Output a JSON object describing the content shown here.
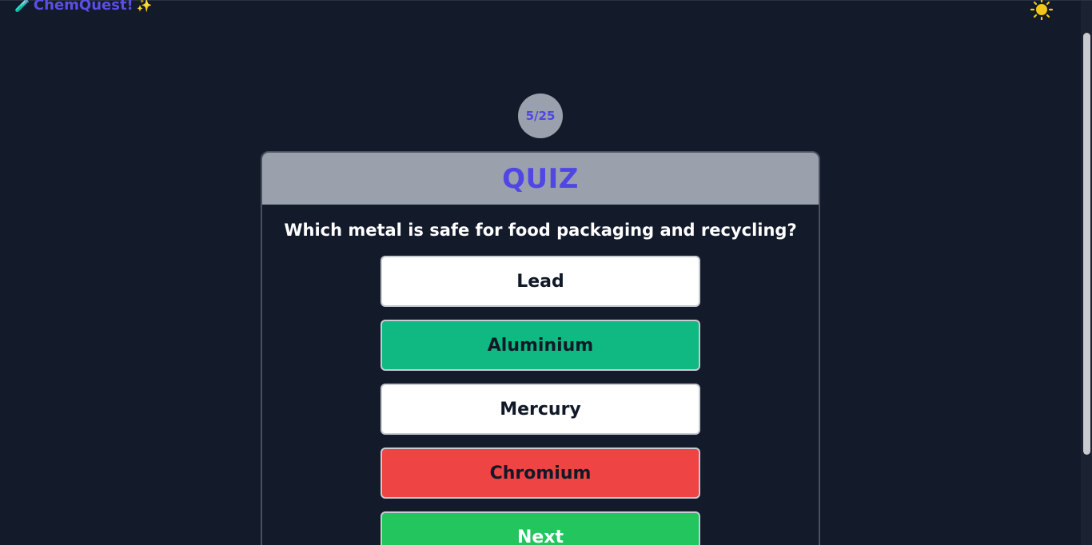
{
  "brand": {
    "title": "ChemQuest!",
    "icon_left": "test-tube-icon",
    "icon_right": "sparkles-icon"
  },
  "theme_toggle": {
    "icon": "sun-icon",
    "color": "#f5c518"
  },
  "quiz": {
    "counter": "5/25",
    "header": "QUIZ",
    "question": "Which metal is safe for food packaging and recycling?",
    "options": [
      {
        "label": "Lead",
        "state": "default"
      },
      {
        "label": "Aluminium",
        "state": "correct"
      },
      {
        "label": "Mercury",
        "state": "default"
      },
      {
        "label": "Chromium",
        "state": "incorrect"
      }
    ],
    "next_label": "Next"
  },
  "colors": {
    "background": "#131a2a",
    "accent": "#4f46e5",
    "correct": "#10b981",
    "incorrect": "#ef4444",
    "next": "#22c55e"
  }
}
